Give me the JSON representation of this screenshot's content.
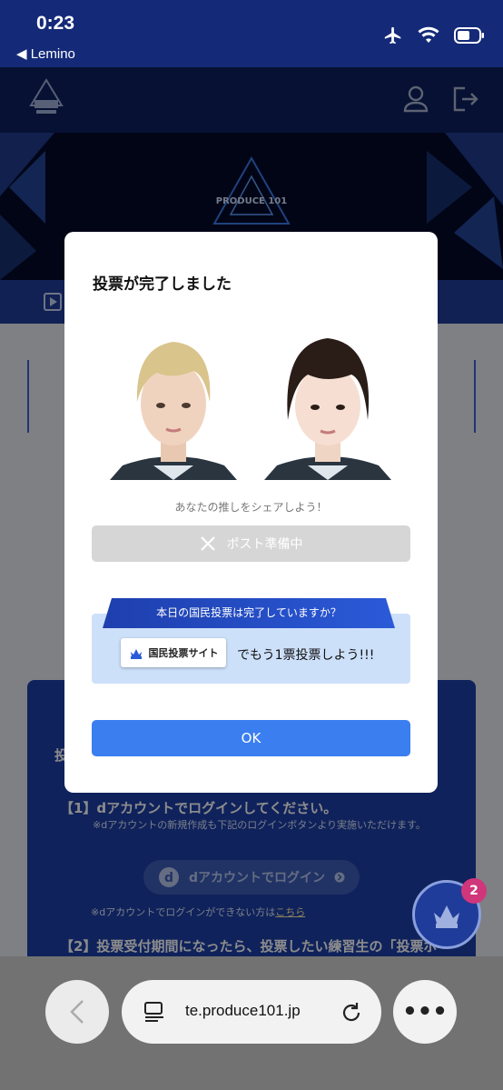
{
  "status_bar": {
    "time": "0:23",
    "back_app": "Lemino"
  },
  "header": {
    "logo_alt": "PRODUCE 101 SHINSEKAI"
  },
  "hero": {
    "logo_text": "PRODUCE 101"
  },
  "background_content": {
    "section_title": "投",
    "step1": "【1】dアカウントでログインしてください。",
    "step1_note": "※dアカウントの新規作成も下記のログインボタンより実施いただけます。",
    "login_button": "dアカウントでログイン",
    "login_help_prefix": "※dアカウントでログインができない方は",
    "login_help_link": "こちら",
    "step2": "【2】投票受付期間になったら、投票したい練習生の「投票ボ"
  },
  "float_badge": {
    "count": "2"
  },
  "modal": {
    "title": "投票が完了しました",
    "share_text": "あなたの推しをシェアしよう！",
    "post_button": "ポスト準備中",
    "vote_question": "本日の国民投票は完了していますか？",
    "site_button": "国民投票サイト",
    "vote_more": "でもう1票投票しよう!!!",
    "ok_button": "OK"
  },
  "browser": {
    "url": "te.produce101.jp"
  },
  "colors": {
    "primary_blue": "#3a7ef0",
    "navy": "#0b1f5e",
    "badge_pink": "#d0367a"
  }
}
